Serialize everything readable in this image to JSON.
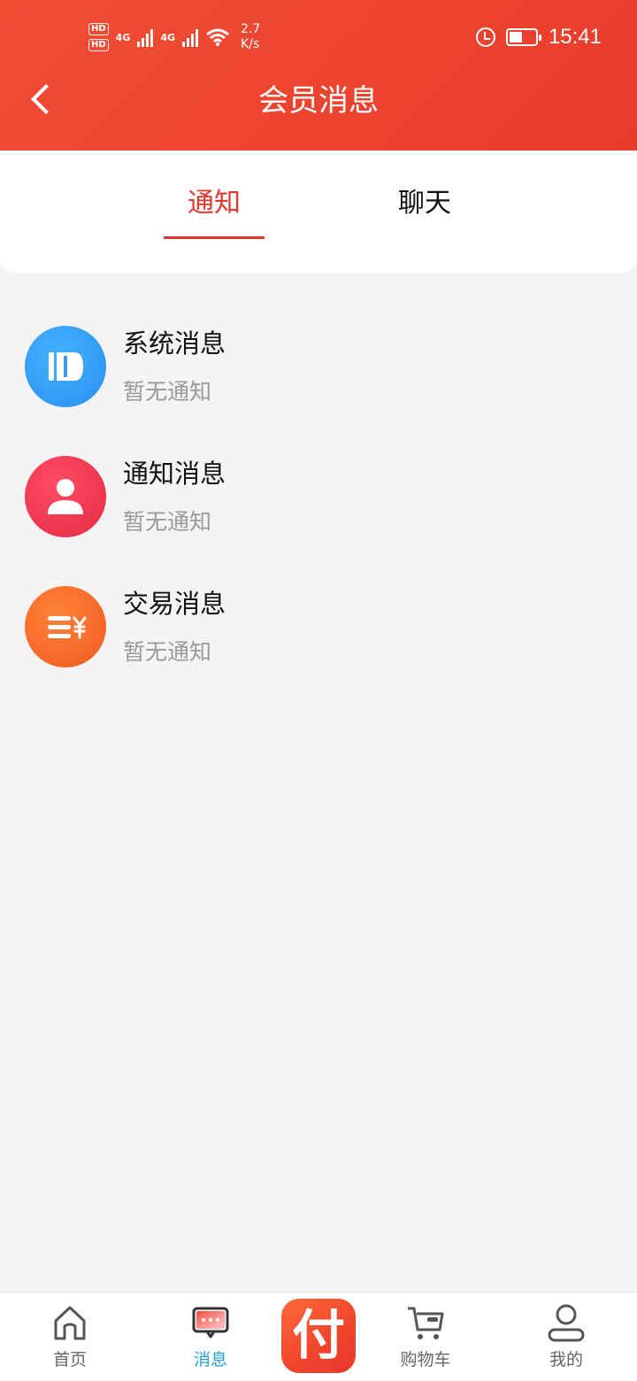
{
  "status_bar": {
    "hd1": "HD",
    "hd2": "HD",
    "net1": "4G",
    "net2": "4G",
    "speed_value": "2.7",
    "speed_unit": "K/s",
    "time": "15:41"
  },
  "header": {
    "title": "会员消息",
    "background_color": "#EE4631"
  },
  "tabs": [
    {
      "label": "通知",
      "active": true
    },
    {
      "label": "聊天",
      "active": false
    }
  ],
  "accent_color": "#E0382C",
  "messages": [
    {
      "title": "系统消息",
      "subtitle": "暂无通知",
      "icon": "megaphone-icon",
      "color": "#2E96F3"
    },
    {
      "title": "通知消息",
      "subtitle": "暂无通知",
      "icon": "person-icon",
      "color": "#EB3049"
    },
    {
      "title": "交易消息",
      "subtitle": "暂无通知",
      "icon": "bill-yuan-icon",
      "color": "#F26127"
    }
  ],
  "bottom_nav": {
    "items": [
      {
        "label": "首页",
        "icon": "home-icon",
        "active": false
      },
      {
        "label": "消息",
        "icon": "chat-icon",
        "active": true
      },
      {
        "label": "购物车",
        "icon": "cart-icon",
        "active": false
      },
      {
        "label": "我的",
        "icon": "user-icon",
        "active": false
      }
    ],
    "pay_label": "付"
  }
}
